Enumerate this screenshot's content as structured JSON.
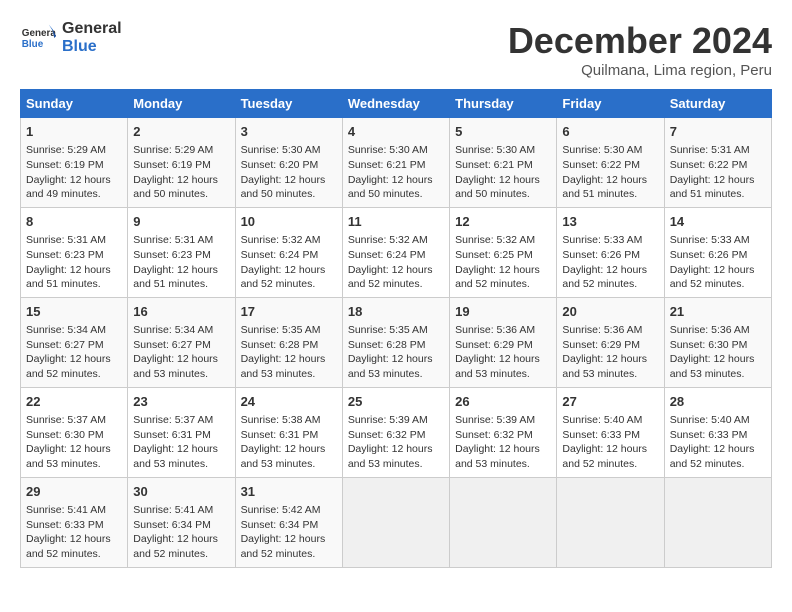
{
  "logo": {
    "text_line1": "General",
    "text_line2": "Blue"
  },
  "title": "December 2024",
  "subtitle": "Quilmana, Lima region, Peru",
  "days_of_week": [
    "Sunday",
    "Monday",
    "Tuesday",
    "Wednesday",
    "Thursday",
    "Friday",
    "Saturday"
  ],
  "weeks": [
    [
      {
        "day": "1",
        "lines": [
          "Sunrise: 5:29 AM",
          "Sunset: 6:19 PM",
          "Daylight: 12 hours",
          "and 49 minutes."
        ]
      },
      {
        "day": "2",
        "lines": [
          "Sunrise: 5:29 AM",
          "Sunset: 6:19 PM",
          "Daylight: 12 hours",
          "and 50 minutes."
        ]
      },
      {
        "day": "3",
        "lines": [
          "Sunrise: 5:30 AM",
          "Sunset: 6:20 PM",
          "Daylight: 12 hours",
          "and 50 minutes."
        ]
      },
      {
        "day": "4",
        "lines": [
          "Sunrise: 5:30 AM",
          "Sunset: 6:21 PM",
          "Daylight: 12 hours",
          "and 50 minutes."
        ]
      },
      {
        "day": "5",
        "lines": [
          "Sunrise: 5:30 AM",
          "Sunset: 6:21 PM",
          "Daylight: 12 hours",
          "and 50 minutes."
        ]
      },
      {
        "day": "6",
        "lines": [
          "Sunrise: 5:30 AM",
          "Sunset: 6:22 PM",
          "Daylight: 12 hours",
          "and 51 minutes."
        ]
      },
      {
        "day": "7",
        "lines": [
          "Sunrise: 5:31 AM",
          "Sunset: 6:22 PM",
          "Daylight: 12 hours",
          "and 51 minutes."
        ]
      }
    ],
    [
      {
        "day": "8",
        "lines": [
          "Sunrise: 5:31 AM",
          "Sunset: 6:23 PM",
          "Daylight: 12 hours",
          "and 51 minutes."
        ]
      },
      {
        "day": "9",
        "lines": [
          "Sunrise: 5:31 AM",
          "Sunset: 6:23 PM",
          "Daylight: 12 hours",
          "and 51 minutes."
        ]
      },
      {
        "day": "10",
        "lines": [
          "Sunrise: 5:32 AM",
          "Sunset: 6:24 PM",
          "Daylight: 12 hours",
          "and 52 minutes."
        ]
      },
      {
        "day": "11",
        "lines": [
          "Sunrise: 5:32 AM",
          "Sunset: 6:24 PM",
          "Daylight: 12 hours",
          "and 52 minutes."
        ]
      },
      {
        "day": "12",
        "lines": [
          "Sunrise: 5:32 AM",
          "Sunset: 6:25 PM",
          "Daylight: 12 hours",
          "and 52 minutes."
        ]
      },
      {
        "day": "13",
        "lines": [
          "Sunrise: 5:33 AM",
          "Sunset: 6:26 PM",
          "Daylight: 12 hours",
          "and 52 minutes."
        ]
      },
      {
        "day": "14",
        "lines": [
          "Sunrise: 5:33 AM",
          "Sunset: 6:26 PM",
          "Daylight: 12 hours",
          "and 52 minutes."
        ]
      }
    ],
    [
      {
        "day": "15",
        "lines": [
          "Sunrise: 5:34 AM",
          "Sunset: 6:27 PM",
          "Daylight: 12 hours",
          "and 52 minutes."
        ]
      },
      {
        "day": "16",
        "lines": [
          "Sunrise: 5:34 AM",
          "Sunset: 6:27 PM",
          "Daylight: 12 hours",
          "and 53 minutes."
        ]
      },
      {
        "day": "17",
        "lines": [
          "Sunrise: 5:35 AM",
          "Sunset: 6:28 PM",
          "Daylight: 12 hours",
          "and 53 minutes."
        ]
      },
      {
        "day": "18",
        "lines": [
          "Sunrise: 5:35 AM",
          "Sunset: 6:28 PM",
          "Daylight: 12 hours",
          "and 53 minutes."
        ]
      },
      {
        "day": "19",
        "lines": [
          "Sunrise: 5:36 AM",
          "Sunset: 6:29 PM",
          "Daylight: 12 hours",
          "and 53 minutes."
        ]
      },
      {
        "day": "20",
        "lines": [
          "Sunrise: 5:36 AM",
          "Sunset: 6:29 PM",
          "Daylight: 12 hours",
          "and 53 minutes."
        ]
      },
      {
        "day": "21",
        "lines": [
          "Sunrise: 5:36 AM",
          "Sunset: 6:30 PM",
          "Daylight: 12 hours",
          "and 53 minutes."
        ]
      }
    ],
    [
      {
        "day": "22",
        "lines": [
          "Sunrise: 5:37 AM",
          "Sunset: 6:30 PM",
          "Daylight: 12 hours",
          "and 53 minutes."
        ]
      },
      {
        "day": "23",
        "lines": [
          "Sunrise: 5:37 AM",
          "Sunset: 6:31 PM",
          "Daylight: 12 hours",
          "and 53 minutes."
        ]
      },
      {
        "day": "24",
        "lines": [
          "Sunrise: 5:38 AM",
          "Sunset: 6:31 PM",
          "Daylight: 12 hours",
          "and 53 minutes."
        ]
      },
      {
        "day": "25",
        "lines": [
          "Sunrise: 5:39 AM",
          "Sunset: 6:32 PM",
          "Daylight: 12 hours",
          "and 53 minutes."
        ]
      },
      {
        "day": "26",
        "lines": [
          "Sunrise: 5:39 AM",
          "Sunset: 6:32 PM",
          "Daylight: 12 hours",
          "and 53 minutes."
        ]
      },
      {
        "day": "27",
        "lines": [
          "Sunrise: 5:40 AM",
          "Sunset: 6:33 PM",
          "Daylight: 12 hours",
          "and 52 minutes."
        ]
      },
      {
        "day": "28",
        "lines": [
          "Sunrise: 5:40 AM",
          "Sunset: 6:33 PM",
          "Daylight: 12 hours",
          "and 52 minutes."
        ]
      }
    ],
    [
      {
        "day": "29",
        "lines": [
          "Sunrise: 5:41 AM",
          "Sunset: 6:33 PM",
          "Daylight: 12 hours",
          "and 52 minutes."
        ]
      },
      {
        "day": "30",
        "lines": [
          "Sunrise: 5:41 AM",
          "Sunset: 6:34 PM",
          "Daylight: 12 hours",
          "and 52 minutes."
        ]
      },
      {
        "day": "31",
        "lines": [
          "Sunrise: 5:42 AM",
          "Sunset: 6:34 PM",
          "Daylight: 12 hours",
          "and 52 minutes."
        ]
      },
      {
        "day": "",
        "lines": []
      },
      {
        "day": "",
        "lines": []
      },
      {
        "day": "",
        "lines": []
      },
      {
        "day": "",
        "lines": []
      }
    ]
  ]
}
